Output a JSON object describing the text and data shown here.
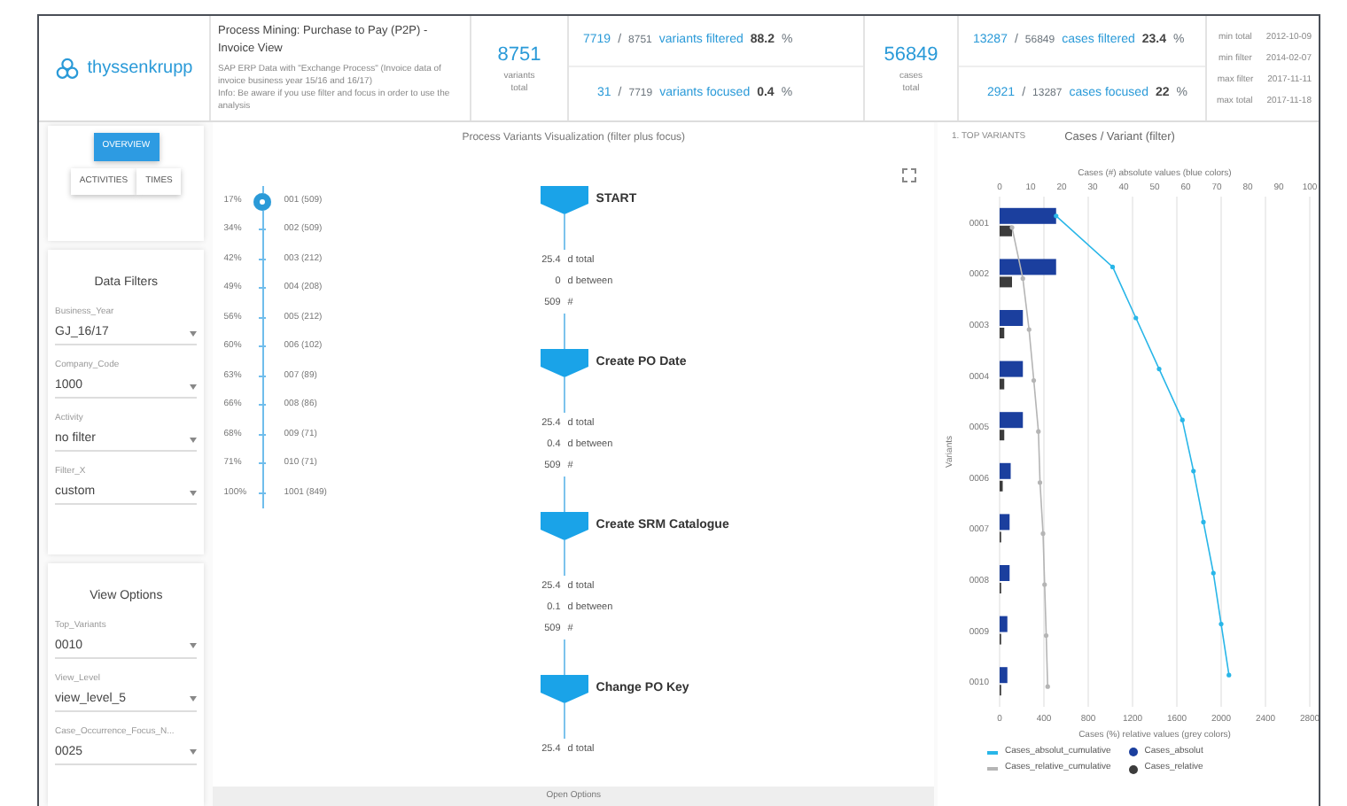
{
  "header": {
    "logo": "thyssenkrupp",
    "title": "Process Mining: Purchase to Pay (P2P) - Invoice View",
    "subtitle_lines": [
      "SAP ERP Data with \"Exchange Process\" (Invoice data of invoice business year 15/16 and 16/17)",
      "Info: Be aware if you use filter and focus in order to use the analysis"
    ]
  },
  "variants": {
    "total": "8751",
    "total_label": "variants total",
    "rows": [
      {
        "count": "7719",
        "separator": "/",
        "of": "8751",
        "label": "variants filtered",
        "percent": "88.2",
        "unit": "%"
      },
      {
        "count": "31",
        "separator": "/",
        "of": "7719",
        "label": "variants focused",
        "percent": "0.4",
        "unit": "%"
      }
    ]
  },
  "cases": {
    "total": "56849",
    "total_label": "cases total",
    "rows": [
      {
        "count": "13287",
        "separator": "/",
        "of": "56849",
        "label": "cases filtered",
        "percent": "23.4",
        "unit": "%"
      },
      {
        "count": "2921",
        "separator": "/",
        "of": "13287",
        "label": "cases focused",
        "percent": "22",
        "unit": "%"
      }
    ]
  },
  "dates": [
    {
      "label": "min total",
      "value": "2012-10-09"
    },
    {
      "label": "min filter",
      "value": "2014-02-07"
    },
    {
      "label": "max filter",
      "value": "2017-11-11"
    },
    {
      "label": "max total",
      "value": "2017-11-18"
    }
  ],
  "tabs": [
    {
      "label": "OVERVIEW",
      "selected": true
    },
    {
      "label": "ACTIVITIES",
      "selected": false
    },
    {
      "label": "TIMES",
      "selected": false
    }
  ],
  "data_filters": {
    "title": "Data Filters",
    "fields": [
      {
        "label": "Business_Year",
        "value": "GJ_16/17"
      },
      {
        "label": "Company_Code",
        "value": "1000"
      },
      {
        "label": "Activity",
        "value": "no filter"
      },
      {
        "label": "Filter_X",
        "value": "custom"
      }
    ]
  },
  "view_options": {
    "title": "View Options",
    "fields": [
      {
        "label": "Top_Variants",
        "value": "0010"
      },
      {
        "label": "View_Level",
        "value": "view_level_5"
      },
      {
        "label": "Case_Occurrence_Focus_N...",
        "value": "0025"
      }
    ]
  },
  "variant_slider": {
    "stops": [
      {
        "percent": "17%",
        "label": "001 (509)",
        "selected": true
      },
      {
        "percent": "34%",
        "label": "002 (509)",
        "selected": false
      },
      {
        "percent": "42%",
        "label": "003 (212)",
        "selected": false
      },
      {
        "percent": "49%",
        "label": "004 (208)",
        "selected": false
      },
      {
        "percent": "56%",
        "label": "005 (212)",
        "selected": false
      },
      {
        "percent": "60%",
        "label": "006 (102)",
        "selected": false
      },
      {
        "percent": "63%",
        "label": "007 (89)",
        "selected": false
      },
      {
        "percent": "66%",
        "label": "008 (86)",
        "selected": false
      },
      {
        "percent": "68%",
        "label": "009 (71)",
        "selected": false
      },
      {
        "percent": "71%",
        "label": "010 (71)",
        "selected": false
      },
      {
        "percent": "100%",
        "label": "1001 (849)",
        "selected": false
      }
    ]
  },
  "flow": {
    "title": "Process Variants Visualization (filter plus focus)",
    "steps": [
      {
        "label": "START",
        "stats": [
          {
            "value": "25.4",
            "unit": "d total"
          },
          {
            "value": "0",
            "unit": "d between"
          },
          {
            "value": "509",
            "unit": "#"
          }
        ]
      },
      {
        "label": "Create PO Date",
        "stats": [
          {
            "value": "25.4",
            "unit": "d total"
          },
          {
            "value": "0.4",
            "unit": "d between"
          },
          {
            "value": "509",
            "unit": "#"
          }
        ]
      },
      {
        "label": "Create SRM Catalogue",
        "stats": [
          {
            "value": "25.4",
            "unit": "d total"
          },
          {
            "value": "0.1",
            "unit": "d between"
          },
          {
            "value": "509",
            "unit": "#"
          }
        ]
      },
      {
        "label": "Change PO Key",
        "stats": [
          {
            "value": "25.4",
            "unit": "d total"
          }
        ]
      }
    ],
    "footer": "Open Options"
  },
  "chart_panel": {
    "tab": "1. TOP VARIANTS",
    "chart_data": {
      "type": "bar",
      "orientation": "horizontal",
      "title": "Cases / Variant (filter)",
      "ylabel": "Variants",
      "xlabel": "Cases (%) relative values (grey colors)",
      "categories": [
        "0001",
        "0002",
        "0003",
        "0004",
        "0005",
        "0006",
        "0007",
        "0008",
        "0009",
        "0010"
      ],
      "xlim": [
        0,
        2800
      ],
      "xticks": [
        0,
        400,
        800,
        1200,
        1600,
        2000,
        2400,
        2800
      ],
      "x2label": "Cases (#) absolute values (blue colors)",
      "x2lim": [
        0,
        100
      ],
      "x2ticks": [
        0,
        10,
        20,
        30,
        40,
        50,
        60,
        70,
        80,
        90,
        100
      ],
      "stacked": false,
      "grid": true,
      "legend": "bottom",
      "series": [
        {
          "name": "Cases_absolut_cumulative",
          "type": "line",
          "color": "#29b6e8",
          "values": [
            510,
            1020,
            1230,
            1440,
            1650,
            1750,
            1840,
            1930,
            2000,
            2070
          ]
        },
        {
          "name": "Cases_absolut",
          "type": "bar",
          "color": "#1b3f9e",
          "values": [
            510,
            510,
            210,
            210,
            210,
            100,
            90,
            90,
            70,
            70
          ]
        },
        {
          "name": "Cases_relative_cumulative",
          "type": "line",
          "axis": "x2",
          "color": "#b5b5b5",
          "values": [
            4,
            7.5,
            9.5,
            11,
            12.5,
            13,
            14,
            14.5,
            15,
            15.5
          ]
        },
        {
          "name": "Cases_relative",
          "type": "bar",
          "axis": "x2",
          "color": "#3c3c3c",
          "values": [
            4,
            4,
            1.5,
            1.5,
            1.5,
            1,
            0.5,
            0.5,
            0.5,
            0.5
          ]
        }
      ]
    }
  }
}
